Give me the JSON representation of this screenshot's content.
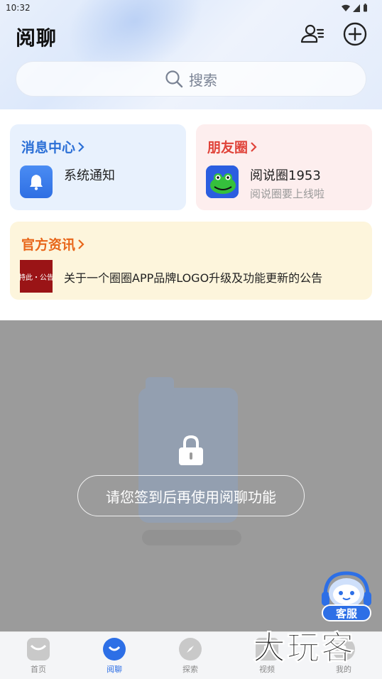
{
  "status_bar": {
    "time": "10:32"
  },
  "header": {
    "title": "阅聊",
    "search_placeholder": "搜索"
  },
  "message_center": {
    "title": "消息中心",
    "item_label": "系统通知"
  },
  "friends_circle": {
    "title": "朋友圈",
    "item_name": "阅说圈1953",
    "item_subtitle": "阅说圈要上线啦"
  },
  "official_news": {
    "title": "官方资讯",
    "thumb_text": "特此・公告",
    "headline": "关于一个圈圈APP品牌LOGO升级及功能更新的公告"
  },
  "locked": {
    "signin_label": "请您签到后再使用阅聊功能"
  },
  "support": {
    "label": "客服"
  },
  "bottom_nav": [
    {
      "label": "首页",
      "icon": "home-icon",
      "active": false
    },
    {
      "label": "阅聊",
      "icon": "chat-icon",
      "active": true
    },
    {
      "label": "探索",
      "icon": "compass-icon",
      "active": false
    },
    {
      "label": "视频",
      "icon": "video-icon",
      "active": false
    },
    {
      "label": "我的",
      "icon": "profile-icon",
      "active": false
    }
  ],
  "watermark": "大玩客",
  "colors": {
    "accent_blue": "#2d6fe6",
    "msg_title": "#2b6fd6",
    "friends_title": "#e0433a",
    "news_title": "#e8661a",
    "overlay_gray": "#9b9b9b"
  }
}
